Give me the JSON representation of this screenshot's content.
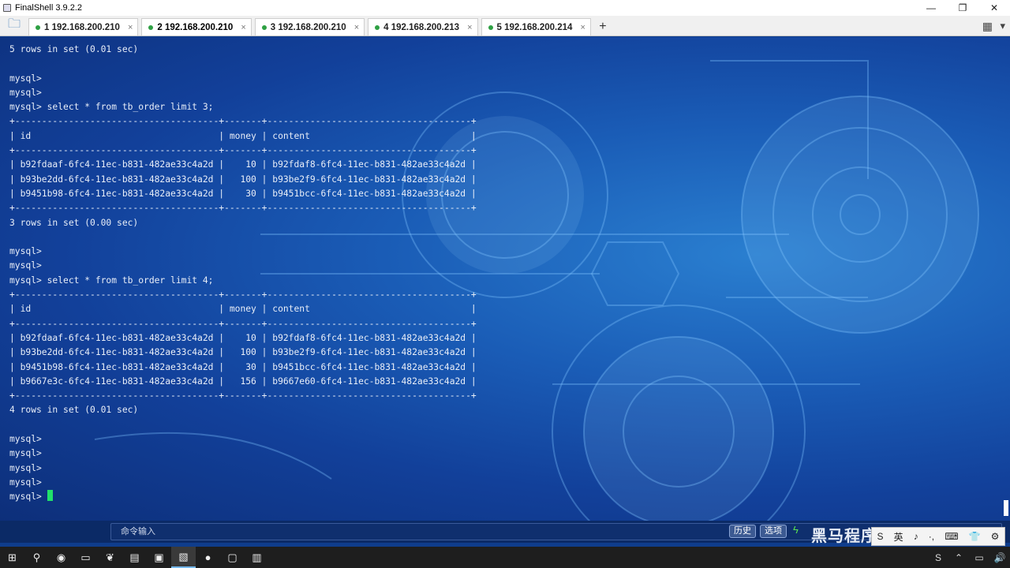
{
  "window": {
    "title": "FinalShell 3.9.2.2",
    "minimize": "—",
    "maximize": "❐",
    "close": "✕"
  },
  "tabs": [
    {
      "label": "1 192.168.200.210",
      "active": false
    },
    {
      "label": "2 192.168.200.210",
      "active": true
    },
    {
      "label": "3 192.168.200.210",
      "active": false
    },
    {
      "label": "4 192.168.200.213",
      "active": false
    },
    {
      "label": "5 192.168.200.214",
      "active": false
    }
  ],
  "tab_close": "×",
  "new_tab": "+",
  "terminal": {
    "lines": [
      "5 rows in set (0.01 sec)",
      "",
      "mysql>",
      "mysql>",
      "mysql> select * from tb_order limit 3;",
      "+--------------------------------------+-------+--------------------------------------+",
      "| id                                   | money | content                              |",
      "+--------------------------------------+-------+--------------------------------------+",
      "| b92fdaaf-6fc4-11ec-b831-482ae33c4a2d |    10 | b92fdaf8-6fc4-11ec-b831-482ae33c4a2d |",
      "| b93be2dd-6fc4-11ec-b831-482ae33c4a2d |   100 | b93be2f9-6fc4-11ec-b831-482ae33c4a2d |",
      "| b9451b98-6fc4-11ec-b831-482ae33c4a2d |    30 | b9451bcc-6fc4-11ec-b831-482ae33c4a2d |",
      "+--------------------------------------+-------+--------------------------------------+",
      "3 rows in set (0.00 sec)",
      "",
      "mysql>",
      "mysql>",
      "mysql> select * from tb_order limit 4;",
      "+--------------------------------------+-------+--------------------------------------+",
      "| id                                   | money | content                              |",
      "+--------------------------------------+-------+--------------------------------------+",
      "| b92fdaaf-6fc4-11ec-b831-482ae33c4a2d |    10 | b92fdaf8-6fc4-11ec-b831-482ae33c4a2d |",
      "| b93be2dd-6fc4-11ec-b831-482ae33c4a2d |   100 | b93be2f9-6fc4-11ec-b831-482ae33c4a2d |",
      "| b9451b98-6fc4-11ec-b831-482ae33c4a2d |    30 | b9451bcc-6fc4-11ec-b831-482ae33c4a2d |",
      "| b9667e3c-6fc4-11ec-b831-482ae33c4a2d |   156 | b9667e60-6fc4-11ec-b831-482ae33c4a2d |",
      "+--------------------------------------+-------+--------------------------------------+",
      "4 rows in set (0.01 sec)",
      "",
      "mysql>",
      "mysql>",
      "mysql>",
      "mysql>"
    ],
    "prompt": "mysql> ",
    "cursor_color": "#21e06a"
  },
  "command_bar": {
    "placeholder": "命令输入",
    "history_label": "历史",
    "options_label": "选项"
  },
  "watermark": "黑马程序员",
  "ime": {
    "items": [
      "S",
      "英",
      "♪",
      "·,",
      "⌨",
      "👕",
      "⚙"
    ]
  },
  "taskbar": {
    "items": [
      {
        "name": "start",
        "glyph": "⊞"
      },
      {
        "name": "search",
        "glyph": "⚲"
      },
      {
        "name": "chrome",
        "glyph": "◉"
      },
      {
        "name": "explorer",
        "glyph": "▭"
      },
      {
        "name": "app-leaf",
        "glyph": "❦"
      },
      {
        "name": "notepad",
        "glyph": "▤"
      },
      {
        "name": "terminal",
        "glyph": "▣"
      },
      {
        "name": "finalshell",
        "glyph": "▧",
        "active": true
      },
      {
        "name": "powerpoint",
        "glyph": "●"
      },
      {
        "name": "app-green",
        "glyph": "▢"
      },
      {
        "name": "app-white",
        "glyph": "▥"
      }
    ],
    "tray": [
      "S",
      "⌃",
      "▭",
      "🔊"
    ]
  },
  "colors": {
    "terminal_text": "#e8eef8",
    "accent_green": "#2ea043",
    "bg_blue": "#1a5cb6"
  }
}
